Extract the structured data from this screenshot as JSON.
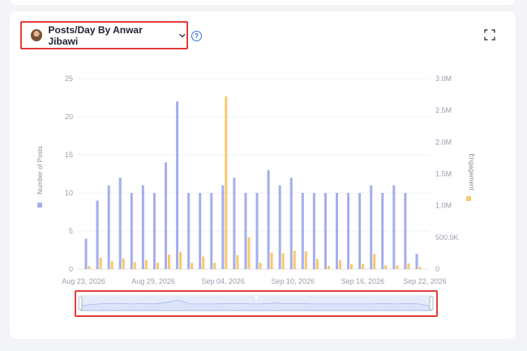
{
  "selector": {
    "label": "Posts/Day By Anwar Jibawi"
  },
  "help": {
    "glyph": "?"
  },
  "icons": {
    "avatar": "avatar-photo",
    "dropdown": "chevron-down-icon",
    "help": "question-circle-icon",
    "expand": "fullscreen-icon"
  },
  "colors": {
    "posts": "#a4aeec",
    "engagement": "#f9c86b",
    "highlight_box": "#e23b3b",
    "help": "#3b6ee8"
  },
  "chart_data": {
    "type": "bar",
    "xlabel": "",
    "y_left_label": "Number of Posts",
    "y_right_label": "Engagement",
    "y_left_ticks": [
      "0",
      "5",
      "10",
      "15",
      "20",
      "25"
    ],
    "y_right_ticks": [
      "0",
      "500.0K",
      "1.0M",
      "1.5M",
      "2.0M",
      "2.5M",
      "3.0M"
    ],
    "x_tick_labels": [
      "Aug 23, 2026",
      "Aug 29, 2026",
      "Sep 04, 2026",
      "Sep 10, 2026",
      "Sep 16, 2026",
      "Sep 22, 2026"
    ],
    "ylim_left": [
      0,
      25
    ],
    "ylim_right": [
      0,
      3000000
    ],
    "series": [
      {
        "name": "Number of Posts",
        "axis": "left",
        "values": [
          4,
          9,
          11,
          12,
          10,
          11,
          10,
          14,
          22,
          10,
          10,
          10,
          11,
          12,
          10,
          10,
          13,
          11,
          12,
          10,
          10,
          10,
          10,
          10,
          10,
          11,
          10,
          11,
          10,
          2
        ]
      },
      {
        "name": "Engagement",
        "axis": "right",
        "values": [
          50000,
          180000,
          130000,
          170000,
          110000,
          140000,
          100000,
          230000,
          270000,
          100000,
          200000,
          100000,
          2720000,
          220000,
          500000,
          100000,
          260000,
          250000,
          290000,
          280000,
          160000,
          50000,
          140000,
          80000,
          80000,
          240000,
          60000,
          60000,
          90000,
          40000
        ]
      }
    ],
    "grid": true,
    "legend": "axis-titles"
  },
  "navigator": {
    "series": [
      4,
      9,
      11,
      12,
      10,
      11,
      10,
      14,
      22,
      10,
      10,
      10,
      11,
      12,
      10,
      10,
      13,
      11,
      12,
      10,
      10,
      10,
      10,
      10,
      10,
      11,
      10,
      11,
      10,
      2
    ],
    "range": [
      0,
      1
    ]
  }
}
